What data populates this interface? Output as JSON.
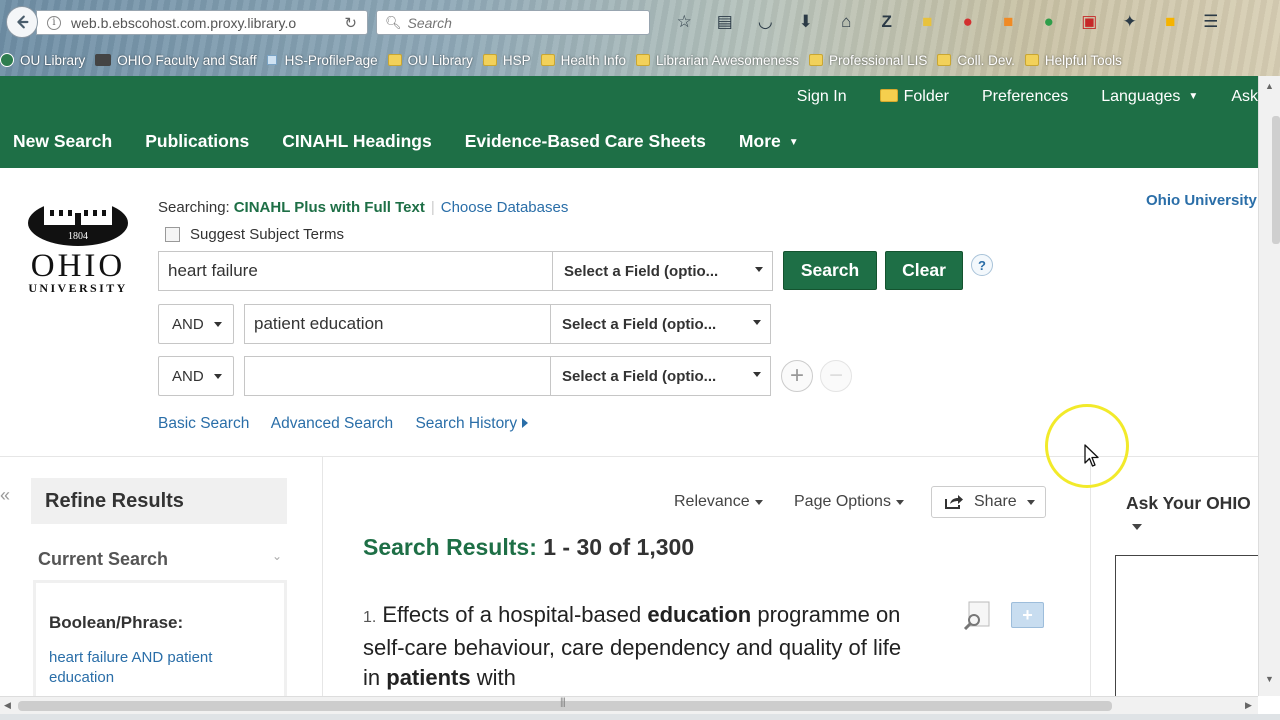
{
  "browser": {
    "url": "web.b.ebscohost.com.proxy.library.o",
    "search_placeholder": "Search",
    "bookmarks": [
      {
        "label": "OU Library",
        "type": "dot"
      },
      {
        "label": "OHIO Faculty and Staff",
        "type": "bus"
      },
      {
        "label": "HS-ProfilePage",
        "type": "page"
      },
      {
        "label": "OU Library",
        "type": "folder"
      },
      {
        "label": "HSP",
        "type": "folder"
      },
      {
        "label": "Health Info",
        "type": "folder"
      },
      {
        "label": "Librarian Awesomeness",
        "type": "folder"
      },
      {
        "label": "Professional LIS",
        "type": "folder"
      },
      {
        "label": "Coll. Dev.",
        "type": "folder"
      },
      {
        "label": "Helpful Tools",
        "type": "folder"
      }
    ],
    "toolbar_icons": [
      "star-icon",
      "reading-list-icon",
      "pocket-icon",
      "download-icon",
      "home-icon",
      "zotero-icon",
      "folder-icon",
      "pinterest-icon",
      "rss-icon",
      "chat-icon",
      "pdf-icon",
      "bird-icon",
      "extension-icon",
      "menu-icon"
    ]
  },
  "header": {
    "top_links": {
      "sign_in": "Sign In",
      "folder": "Folder",
      "preferences": "Preferences",
      "languages": "Languages",
      "ask": "Ask"
    },
    "nav": {
      "new_search": "New Search",
      "publications": "Publications",
      "cinahl": "CINAHL Headings",
      "ebcs": "Evidence-Based Care Sheets",
      "more": "More"
    }
  },
  "logo": {
    "line1": "OHIO",
    "line2": "UNIVERSITY",
    "year": "1804"
  },
  "search": {
    "searching_label": "Searching:",
    "database": "CINAHL Plus with Full Text",
    "choose_databases": "Choose Databases",
    "suggest_terms": "Suggest Subject Terms",
    "rows": [
      {
        "operator": "",
        "value": "heart failure",
        "field": "Select a Field (optio..."
      },
      {
        "operator": "AND",
        "value": "patient education",
        "field": "Select a Field (optio..."
      },
      {
        "operator": "AND",
        "value": "",
        "field": "Select a Field (optio..."
      }
    ],
    "search_button": "Search",
    "clear_button": "Clear",
    "help": "?",
    "links": {
      "basic": "Basic Search",
      "advanced": "Advanced Search",
      "history": "Search History"
    },
    "institution": "Ohio University"
  },
  "refine": {
    "title": "Refine Results",
    "current_search": "Current Search",
    "boolean_label": "Boolean/Phrase:",
    "boolean_value": "heart failure AND patient education"
  },
  "results": {
    "sort": "Relevance",
    "page_options": "Page Options",
    "share": "Share",
    "title_label": "Search Results:",
    "range": "1 - 30 of 1,300",
    "first_result": {
      "number": "1.",
      "parts": [
        {
          "t": "Effects of a hospital-based ",
          "b": false
        },
        {
          "t": "education",
          "b": true
        },
        {
          "t": " programme on self-care behaviour, care dependency and quality of life in ",
          "b": false
        },
        {
          "t": "patients",
          "b": true
        },
        {
          "t": " with",
          "b": false
        }
      ]
    }
  },
  "right_panel": {
    "title": "Ask Your OHIO"
  },
  "colors": {
    "brand_green": "#1e6f46",
    "link_blue": "#2a6ea8",
    "highlight_yellow": "#f2ea2a"
  }
}
